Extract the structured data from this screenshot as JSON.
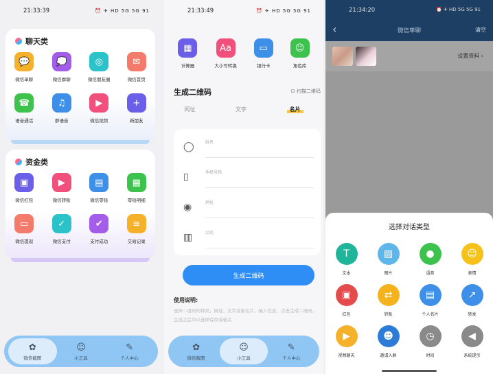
{
  "p1": {
    "time": "21:33:39",
    "status_icons": "⏰ ✈ HD 5G 5G 91",
    "chat_section": {
      "title": "聊天类",
      "items": [
        {
          "label": "微信单聊",
          "color": "#f6b12a",
          "icon": "💬"
        },
        {
          "label": "微信群聊",
          "color": "#a35de8",
          "icon": "💭"
        },
        {
          "label": "微信朋友圈",
          "color": "#2bc3c9",
          "icon": "◎"
        },
        {
          "label": "微信首页",
          "color": "#f47b6b",
          "icon": "✉"
        },
        {
          "label": "语音通话",
          "color": "#3cc24d",
          "icon": "☎"
        },
        {
          "label": "群语音",
          "color": "#3d8fe8",
          "icon": "♫"
        },
        {
          "label": "微信视频",
          "color": "#f1507c",
          "icon": "▶"
        },
        {
          "label": "新朋友",
          "color": "#6b5ee8",
          "icon": "+"
        }
      ]
    },
    "money_section": {
      "title": "资金类",
      "items": [
        {
          "label": "微信红包",
          "color": "#6b5ee8",
          "icon": "▣"
        },
        {
          "label": "微信转账",
          "color": "#f1507c",
          "icon": "▶"
        },
        {
          "label": "微信零钱",
          "color": "#3d8fe8",
          "icon": "▤"
        },
        {
          "label": "零钱明细",
          "color": "#3cc24d",
          "icon": "▦"
        },
        {
          "label": "微信提现",
          "color": "#f47b6b",
          "icon": "▭"
        },
        {
          "label": "微信支付",
          "color": "#2bc3c9",
          "icon": "✓"
        },
        {
          "label": "支付成功",
          "color": "#a35de8",
          "icon": "✔"
        },
        {
          "label": "交易记录",
          "color": "#f6b12a",
          "icon": "≡"
        }
      ]
    },
    "tabs": [
      {
        "label": "微信截图",
        "icon": "✿"
      },
      {
        "label": "小工具",
        "icon": "☺"
      },
      {
        "label": "个人中心",
        "icon": "✎"
      }
    ]
  },
  "p2": {
    "time": "21:33:49",
    "status_icons": "⏰ ✈ HD 5G 5G 91",
    "tools": [
      {
        "label": "计算器",
        "color": "#6b5ee8",
        "icon": "▦"
      },
      {
        "label": "大小写转换",
        "color": "#f1507c",
        "icon": "Aa"
      },
      {
        "label": "银行卡",
        "color": "#3d8fe8",
        "icon": "▭"
      },
      {
        "label": "角色库",
        "color": "#3cc24d",
        "icon": "☺"
      }
    ],
    "qr_title": "生成二维码",
    "scan_label": "⊡ 扫描二维码",
    "qr_tabs": [
      "网址",
      "文字",
      "名片"
    ],
    "form_rows": [
      {
        "placeholder": "姓名",
        "icon": "◯"
      },
      {
        "placeholder": "手机号码",
        "icon": "▯"
      },
      {
        "placeholder": "地址",
        "icon": "◉"
      },
      {
        "placeholder": "公司",
        "icon": "▥"
      }
    ],
    "generate_label": "生成二维码",
    "usage_title": "使用说明:",
    "usage_text": "选择二维码的种类，网址，文字或者名片，输入信息，点击生成二维码，生成之后可以选择保存或者关",
    "tabs": [
      {
        "label": "微信截图",
        "icon": "✿"
      },
      {
        "label": "小工具",
        "icon": "☺"
      },
      {
        "label": "个人中心",
        "icon": "✎"
      }
    ]
  },
  "p3": {
    "time": "21:34:20",
    "status_icons": "⏰ ✈ HD 5G 5G 91",
    "title": "微信单聊",
    "clear_label": "清空",
    "settings_label": "设置资料 ›",
    "sheet_title": "选择对话类型",
    "types": [
      {
        "label": "文本",
        "color": "#1fb59a",
        "icon": "T"
      },
      {
        "label": "图片",
        "color": "#5fb6ea",
        "icon": "▨"
      },
      {
        "label": "语音",
        "color": "#3cc24d",
        "icon": "●"
      },
      {
        "label": "表情",
        "color": "#f6c21a",
        "icon": "☺"
      },
      {
        "label": "红包",
        "color": "#e44c4c",
        "icon": "▣"
      },
      {
        "label": "转账",
        "color": "#f4b21c",
        "icon": "⇄"
      },
      {
        "label": "个人名片",
        "color": "#3d8fe8",
        "icon": "▤"
      },
      {
        "label": "转发",
        "color": "#3d8fe8",
        "icon": "↗"
      },
      {
        "label": "视频聊天",
        "color": "#f6b12a",
        "icon": "▶"
      },
      {
        "label": "邀请入群",
        "color": "#2c7bd6",
        "icon": "☻"
      },
      {
        "label": "时间",
        "color": "#8a8a8a",
        "icon": "◷"
      },
      {
        "label": "系统提示",
        "color": "#8a8a8a",
        "icon": "◀"
      }
    ]
  }
}
